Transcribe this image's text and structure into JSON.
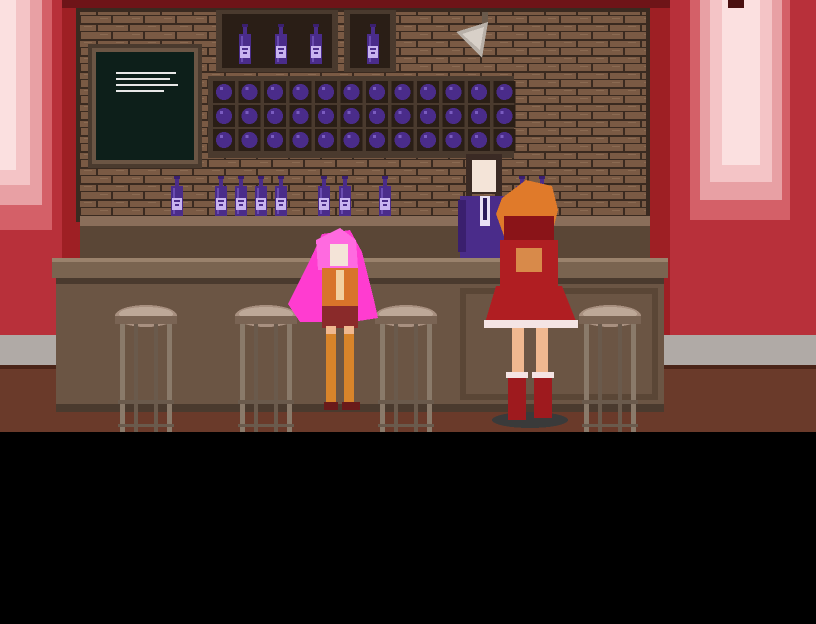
{
  "game": {
    "scene": "bar-interior",
    "dialogue_text": "",
    "colors": {
      "wall_red": "#9e1f24",
      "curtain_pink": "#e8a0a4",
      "brick": "#7a5a44",
      "mortar": "#3a2a20",
      "wood_counter": "#6b5544",
      "wood_dark": "#4a3a2e",
      "bottle": "#4a2c8a",
      "bottle_label": "#c8b4f0",
      "chalkboard": "#0d1f1a",
      "chalk": "#e8e8e8",
      "floor": "#6a3a2a",
      "stool_seat": "#a89080",
      "stool_legs": "#8a7a6a",
      "char_pink_hair": "#ff3cd0",
      "char_orange_hair": "#e07a2a",
      "bartender_suit": "#4a2c8a",
      "dress_red": "#b01e22"
    }
  }
}
